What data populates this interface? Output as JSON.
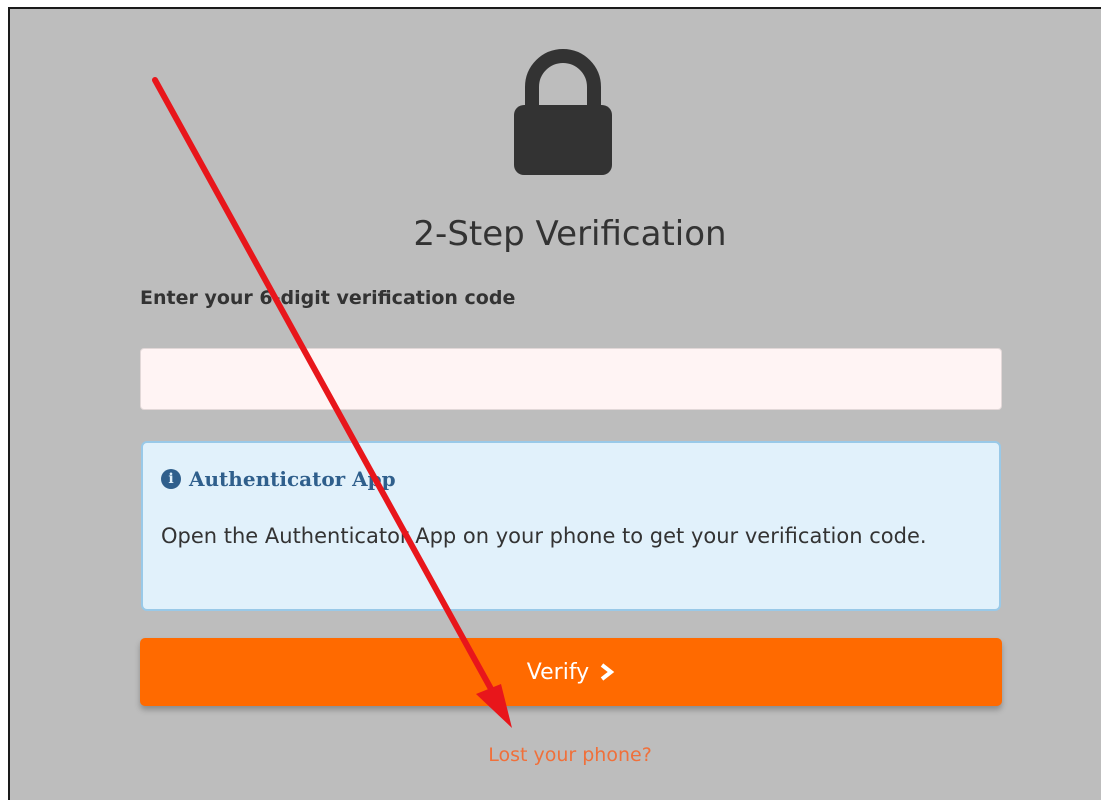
{
  "header": {
    "lock_icon": "lock-icon",
    "title": "2-Step Verification"
  },
  "form": {
    "code_label": "Enter your 6-digit verification code",
    "code_value": "",
    "code_placeholder": ""
  },
  "info": {
    "icon": "info-circle-icon",
    "heading": "Authenticator App",
    "body": "Open the Authenticator App on your phone to get your verification code."
  },
  "actions": {
    "verify_label": "Verify",
    "verify_icon": "chevron-right-icon",
    "lost_phone_link": "Lost your phone?"
  },
  "annotation": {
    "arrow_color": "#e8161b"
  },
  "colors": {
    "accent": "#ff6a00",
    "link": "#f0703a",
    "info_bg": "#e1f1fb",
    "info_border": "#99c9e8",
    "page_bg": "#bdbdbd"
  }
}
